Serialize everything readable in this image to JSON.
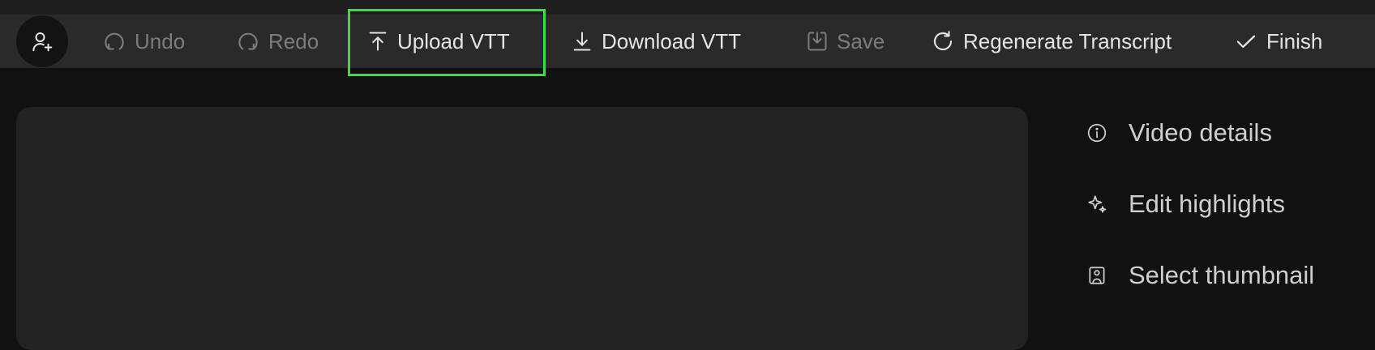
{
  "toolbar": {
    "undo_label": "Undo",
    "redo_label": "Redo",
    "upload_label": "Upload VTT",
    "download_label": "Download VTT",
    "save_label": "Save",
    "regenerate_label": "Regenerate Transcript",
    "finish_label": "Finish"
  },
  "sidebar": {
    "items": [
      {
        "label": "Video details",
        "icon": "info-icon"
      },
      {
        "label": "Edit highlights",
        "icon": "sparkle-icon"
      },
      {
        "label": "Select thumbnail",
        "icon": "image-icon"
      }
    ]
  },
  "colors": {
    "background": "#111111",
    "toolbar": "#2a2a2a",
    "panel": "#222222",
    "highlight": "#3fdc3f",
    "text": "#e4e4e4",
    "disabled_text": "#7c7c7c"
  }
}
